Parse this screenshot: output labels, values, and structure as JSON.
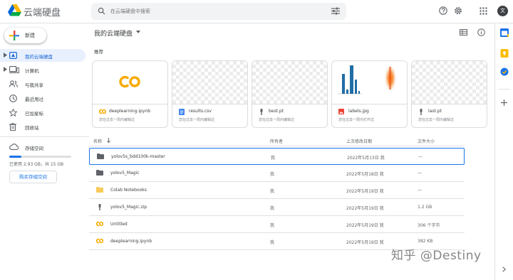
{
  "app": {
    "title": "云端硬盘"
  },
  "search": {
    "placeholder": "在云端硬盘中搜索"
  },
  "header": {
    "avatar_letter": "文"
  },
  "sidebar": {
    "new_label": "新建",
    "items": [
      {
        "label": "我的云端硬盘",
        "icon": "drive-icon",
        "active": true
      },
      {
        "label": "计算机",
        "icon": "computer-icon"
      },
      {
        "label": "与我共享",
        "icon": "shared-icon"
      },
      {
        "label": "最近用过",
        "icon": "clock-icon"
      },
      {
        "label": "已加星标",
        "icon": "star-icon"
      },
      {
        "label": "回收站",
        "icon": "trash-icon"
      }
    ],
    "storage": {
      "label": "存储空间",
      "used_text": "已使用 2.93 GB，共 15 GB",
      "used_fraction": 0.2,
      "buy_label": "购买存储空间"
    }
  },
  "main": {
    "breadcrumb": "我的云端硬盘",
    "suggested_label": "推荐",
    "cards": [
      {
        "name": "deeplearning.ipynb",
        "sub": "您在过去一周内编辑过",
        "type": "colab"
      },
      {
        "name": "results.csv",
        "sub": "您在过去一周内编辑过",
        "type": "doc"
      },
      {
        "name": "best.pt",
        "sub": "您在过去一周内编辑过",
        "type": "file"
      },
      {
        "name": "labels.jpg",
        "sub": "您在过去一周内打开过",
        "type": "image"
      },
      {
        "name": "last.pt",
        "sub": "您在过去一周内编辑过",
        "type": "file"
      }
    ],
    "columns": {
      "name": "名称",
      "owner": "所有者",
      "modified": "上次修改日期",
      "size": "文件大小"
    },
    "rows": [
      {
        "name": "yolov5s_bdd100k-master",
        "owner": "我",
        "modified": "2022年5月13日 我",
        "size": "—",
        "type": "folder-dark"
      },
      {
        "name": "yolov5_Magic",
        "owner": "我",
        "modified": "2022年5月18日 我",
        "size": "—",
        "type": "folder-dark"
      },
      {
        "name": "Colab Notebooks",
        "owner": "我",
        "modified": "2022年5月19日 我",
        "size": "—",
        "type": "folder-yellow"
      },
      {
        "name": "yolov5_Magic.zip",
        "owner": "我",
        "modified": "2022年5月19日 我",
        "size": "1.2 GB",
        "type": "zip"
      },
      {
        "name": "Untitled",
        "owner": "我",
        "modified": "2022年5月19日 我",
        "size": "306 个字节",
        "type": "colab"
      },
      {
        "name": "deeplearning.ipynb",
        "owner": "我",
        "modified": "2022年5月19日 我",
        "size": "382 KB",
        "type": "colab"
      }
    ]
  },
  "watermark": "知乎 @Destiny",
  "colors": {
    "accent": "#1a73e8",
    "colab_orange": "#f9ab00",
    "folder_yellow": "#f8ca5b"
  }
}
